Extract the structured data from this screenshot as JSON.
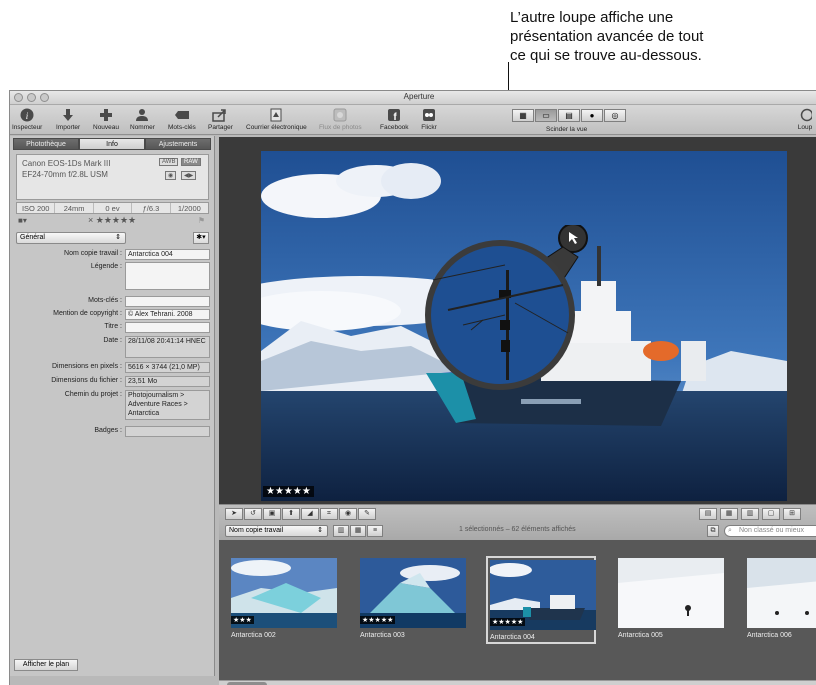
{
  "annotation": {
    "line1": "L’autre loupe affiche une",
    "line2": "présentation avancée de tout",
    "line3": "ce qui se trouve au-dessous."
  },
  "window": {
    "title": "Aperture"
  },
  "toolbar": {
    "items": [
      {
        "label": "Inspecteur",
        "icon": "info-icon"
      },
      {
        "label": "Importer",
        "icon": "import-arrow-icon"
      },
      {
        "label": "Nouveau",
        "icon": "plus-icon"
      },
      {
        "label": "Nommer",
        "icon": "person-icon"
      },
      {
        "label": "Mots-clés",
        "icon": "tag-icon"
      },
      {
        "label": "Partager",
        "icon": "share-icon"
      },
      {
        "label": "Courrier électronique",
        "icon": "stamp-icon"
      },
      {
        "label": "Flux de photos",
        "icon": "photostream-icon"
      },
      {
        "label": "Facebook",
        "icon": "facebook-icon"
      },
      {
        "label": "Flickr",
        "icon": "flickr-icon"
      }
    ],
    "split_view_label": "Scinder la vue",
    "loupe_label": "Loup"
  },
  "inspector": {
    "tabs": [
      "Photothèque",
      "Info",
      "Ajustements"
    ],
    "active_tab": "Info",
    "camera": "Canon EOS-1Ds Mark III",
    "lens": "EF24-70mm f/2.8L USM",
    "badge_awb": "AWB",
    "badge_raw": "RAW",
    "exif": [
      "ISO 200",
      "24mm",
      "0 ev",
      "ƒ/6.3",
      "1/2000"
    ],
    "rating": "× ★★★★★",
    "preset": "Général",
    "fields": [
      {
        "label": "Nom copie travail :",
        "value": "Antarctica 004"
      },
      {
        "label": "Légende :",
        "value": ""
      },
      {
        "label": "Mots-clés :",
        "value": ""
      },
      {
        "label": "Mention de copyright :",
        "value": "© Alex Tehrani. 2008"
      },
      {
        "label": "Titre :",
        "value": ""
      },
      {
        "label": "Date :",
        "value": "28/11/08 20:41:14 HNEC"
      },
      {
        "label": "Dimensions en pixels :",
        "value": "5616 × 3744 (21,0 MP)"
      },
      {
        "label": "Dimensions du fichier :",
        "value": "23,51 Mo"
      },
      {
        "label": "Chemin du projet :",
        "value": "Photojournalism > Adventure Races > Antarctica"
      },
      {
        "label": "Badges :",
        "value": ""
      }
    ],
    "plan_button": "Afficher le plan"
  },
  "viewer": {
    "rating": "★★★★★"
  },
  "browser": {
    "sort_select": "Nom copie travail",
    "count_text": "1 sélectionnés – 62 éléments affichés",
    "search_placeholder": "Non classé ou mieux"
  },
  "thumbnails": [
    {
      "name": "Antarctica 002",
      "stars": "★★★"
    },
    {
      "name": "Antarctica 003",
      "stars": "★★★★★"
    },
    {
      "name": "Antarctica 004",
      "stars": "★★★★★"
    },
    {
      "name": "Antarctica 005",
      "stars": ""
    },
    {
      "name": "Antarctica 006",
      "stars": ""
    }
  ]
}
